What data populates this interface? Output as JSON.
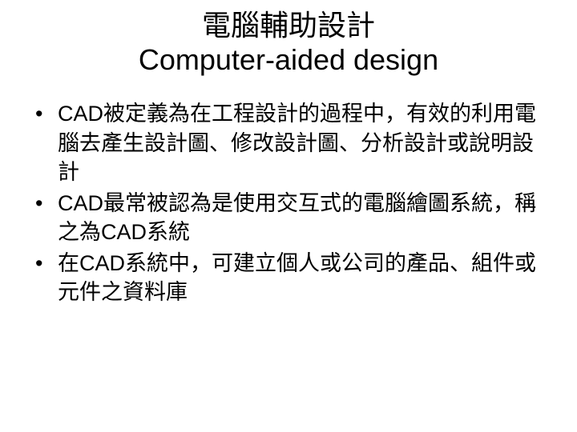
{
  "title": {
    "line1": "電腦輔助設計",
    "line2": "Computer-aided design"
  },
  "bullets": [
    "CAD被定義為在工程設計的過程中，有效的利用電腦去產生設計圖、修改設計圖、分析設計或說明設計",
    "CAD最常被認為是使用交互式的電腦繪圖系統，稱之為CAD系統",
    "在CAD系統中，可建立個人或公司的產品、組件或元件之資料庫"
  ]
}
